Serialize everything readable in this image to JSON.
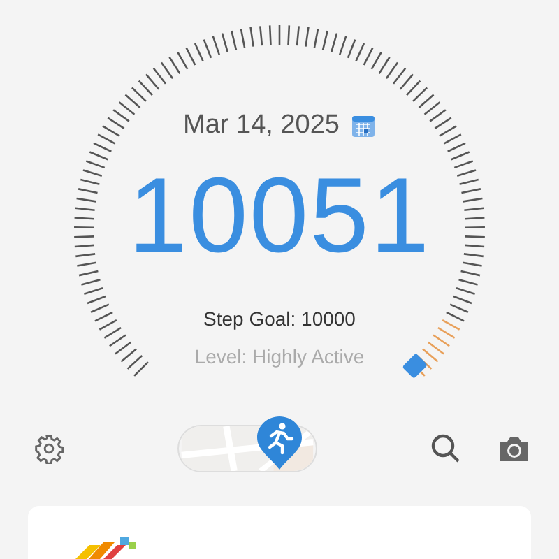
{
  "date": "Mar 14, 2025",
  "steps": "10051",
  "goal": "Step Goal: 10000",
  "activity": "Level: Highly Active"
}
